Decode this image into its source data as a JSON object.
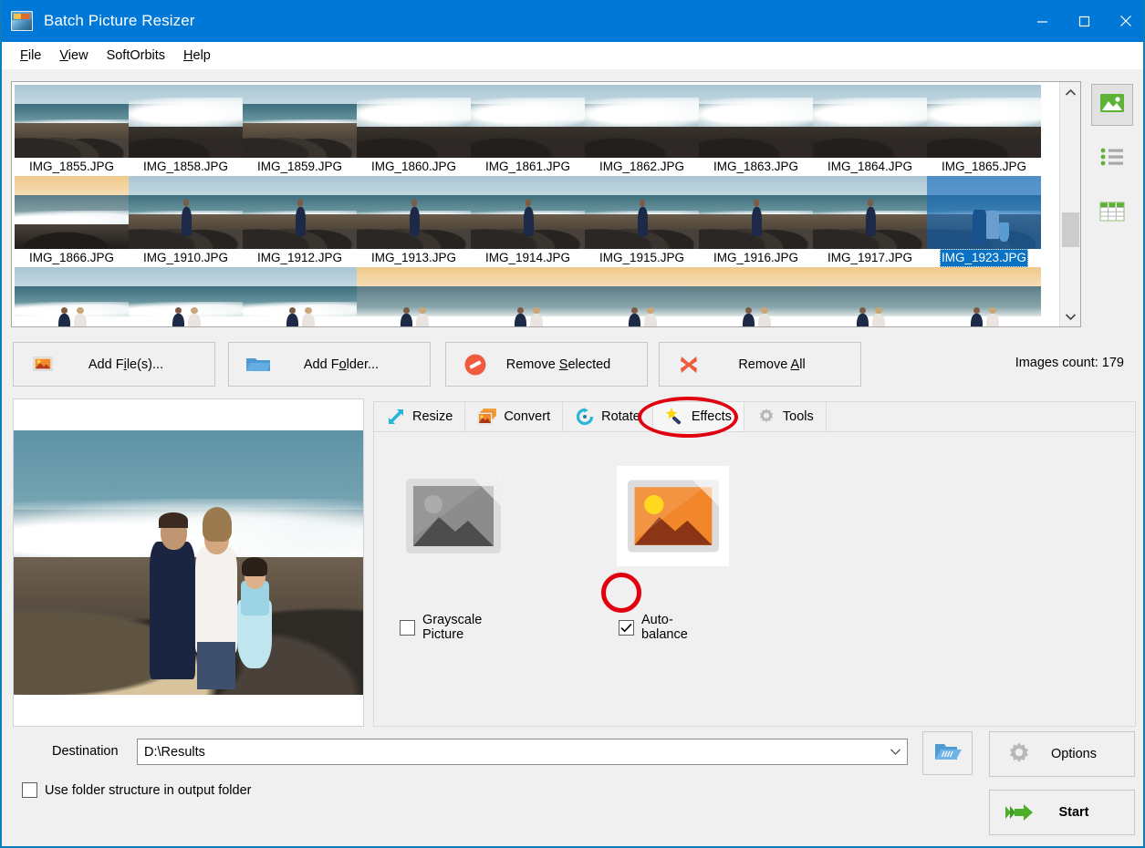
{
  "window": {
    "title": "Batch Picture Resizer",
    "icon": "app-picture-icon",
    "controls": [
      {
        "name": "minimize",
        "glyph": "minimize-icon"
      },
      {
        "name": "maximize",
        "glyph": "maximize-icon"
      },
      {
        "name": "close",
        "glyph": "close-icon"
      }
    ],
    "title_bar_color": "#0078d7",
    "border_color": "#0c7cba"
  },
  "menubar": {
    "items": [
      {
        "label": "File",
        "accel": "F"
      },
      {
        "label": "View",
        "accel": "V"
      },
      {
        "label": "SoftOrbits",
        "accel": ""
      },
      {
        "label": "Help",
        "accel": "H"
      }
    ]
  },
  "thumbnails": {
    "selected": "IMG_1923.JPG",
    "selection_color": "#0a72c4",
    "items": [
      {
        "label": "IMG_1855.JPG",
        "scene": "rocks"
      },
      {
        "label": "IMG_1858.JPG",
        "scene": "wave"
      },
      {
        "label": "IMG_1859.JPG",
        "scene": "rocks"
      },
      {
        "label": "IMG_1860.JPG",
        "scene": "wave"
      },
      {
        "label": "IMG_1861.JPG",
        "scene": "wave"
      },
      {
        "label": "IMG_1862.JPG",
        "scene": "wave"
      },
      {
        "label": "IMG_1863.JPG",
        "scene": "wave"
      },
      {
        "label": "IMG_1864.JPG",
        "scene": "wave"
      },
      {
        "label": "IMG_1865.JPG",
        "scene": "wave"
      },
      {
        "label": "IMG_1866.JPG",
        "scene": "sunset"
      },
      {
        "label": "IMG_1910.JPG",
        "scene": "person"
      },
      {
        "label": "IMG_1912.JPG",
        "scene": "person"
      },
      {
        "label": "IMG_1913.JPG",
        "scene": "person"
      },
      {
        "label": "IMG_1914.JPG",
        "scene": "person"
      },
      {
        "label": "IMG_1915.JPG",
        "scene": "person"
      },
      {
        "label": "IMG_1916.JPG",
        "scene": "person"
      },
      {
        "label": "IMG_1917.JPG",
        "scene": "person"
      },
      {
        "label": "IMG_1923.JPG",
        "scene": "family",
        "selected": true
      },
      {
        "label": "",
        "scene": "couple"
      },
      {
        "label": "",
        "scene": "couple"
      },
      {
        "label": "",
        "scene": "couple"
      },
      {
        "label": "",
        "scene": "sunset-couple"
      },
      {
        "label": "",
        "scene": "sunset-couple"
      },
      {
        "label": "",
        "scene": "sunset-couple"
      },
      {
        "label": "",
        "scene": "sunset-couple"
      },
      {
        "label": "",
        "scene": "sunset-couple"
      },
      {
        "label": "",
        "scene": "sunset-couple"
      }
    ],
    "scrollbar": {
      "up": "chevron-up-icon",
      "down": "chevron-down-icon"
    }
  },
  "view_modes": [
    {
      "name": "thumbnails-view",
      "icon": "picture-icon",
      "active": true
    },
    {
      "name": "list-view",
      "icon": "list-icon",
      "active": false
    },
    {
      "name": "details-view",
      "icon": "table-icon",
      "active": false
    }
  ],
  "actions": {
    "add_files": {
      "label": "Add File(s)...",
      "accel": "i",
      "icon": "picture-add-icon"
    },
    "add_folder": {
      "label": "Add Folder...",
      "accel": "o",
      "icon": "folder-icon"
    },
    "remove_selected": {
      "label": "Remove Selected",
      "accel": "S",
      "icon": "no-entry-icon"
    },
    "remove_all": {
      "label": "Remove All",
      "accel": "A",
      "icon": "red-x-icon"
    },
    "images_count": "Images count: 179"
  },
  "tabs": [
    {
      "label": "Resize",
      "icon": "resize-arrow-icon",
      "active": false
    },
    {
      "label": "Convert",
      "icon": "convert-stack-icon",
      "active": false
    },
    {
      "label": "Rotate",
      "icon": "rotate-icon",
      "active": false
    },
    {
      "label": "Effects",
      "icon": "magic-wand-icon",
      "active": true
    },
    {
      "label": "Tools",
      "icon": "gear-icon",
      "active": false
    }
  ],
  "effects_panel": {
    "grayscale_preview": {
      "name": "grayscale-picture-thumb",
      "selected": false
    },
    "color_preview": {
      "name": "color-picture-thumb",
      "selected": true
    },
    "checkboxes": [
      {
        "label": "Grayscale Picture",
        "checked": false
      },
      {
        "label": "Auto-balance",
        "checked": true
      }
    ]
  },
  "destination": {
    "label": "Destination",
    "value": "D:\\Results",
    "dropdown_icon": "chevron-down-icon",
    "browse_icon": "open-folder-icon",
    "use_folder_structure": {
      "label": "Use folder structure in output folder",
      "checked": false
    }
  },
  "bottom_buttons": {
    "options": {
      "label": "Options",
      "icon": "gear-icon"
    },
    "start": {
      "label": "Start",
      "icon": "green-arrow-icon"
    }
  },
  "annotations": [
    {
      "name": "effects-tab-highlight",
      "shape": "ellipse",
      "color": "#e1000f"
    },
    {
      "name": "auto-balance-checkbox-highlight",
      "shape": "circle",
      "color": "#e1000f"
    }
  ]
}
